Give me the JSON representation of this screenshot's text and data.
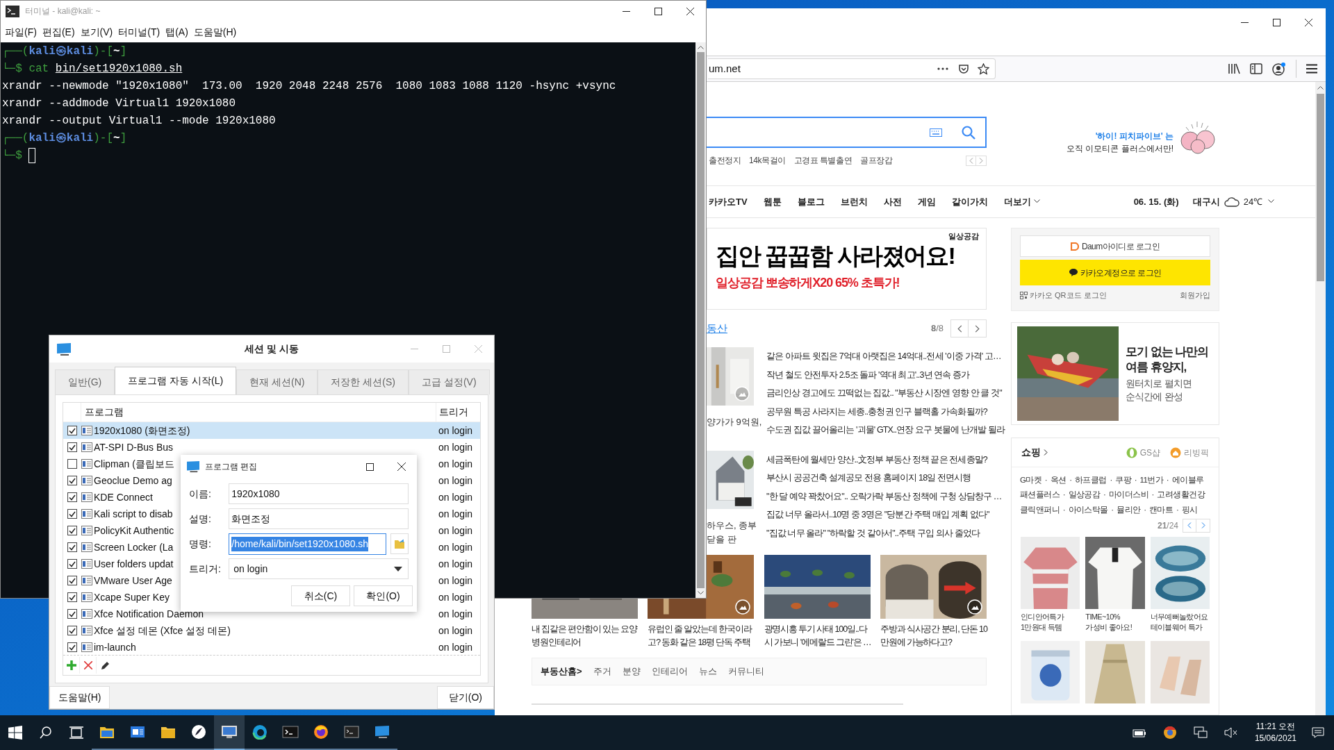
{
  "terminal": {
    "title": "터미널 - kali@kali: ~",
    "menu": [
      "파일(F)",
      "편집(E)",
      "보기(V)",
      "터미널(T)",
      "탭(A)",
      "도움말(H)"
    ],
    "lines": [
      {
        "kind": "prompt",
        "corner": "┌──(",
        "user": "kali",
        "at": "㉿",
        "host": "kali",
        "mid": ")-[",
        "dir": "~",
        "end": "]"
      },
      {
        "kind": "command",
        "corner": "└─$",
        "command": "cat",
        "argument": "bin/set1920x1080.sh"
      },
      {
        "kind": "output",
        "text": "xrandr --newmode \"1920x1080\"  173.00  1920 2048 2248 2576  1080 1083 1088 1120 -hsync +vsync"
      },
      {
        "kind": "output",
        "text": "xrandr --addmode Virtual1 1920x1080"
      },
      {
        "kind": "output",
        "text": "xrandr --output Virtual1 --mode 1920x1080"
      },
      {
        "kind": "prompt",
        "corner": "┌──(",
        "user": "kali",
        "at": "㉿",
        "host": "kali",
        "mid": ")-[",
        "dir": "~",
        "end": "]"
      },
      {
        "kind": "input",
        "corner": "└─$",
        "cursor": true
      }
    ]
  },
  "session_dialog": {
    "title": "세션 및 시동",
    "tabs": [
      {
        "label": "일반(G)",
        "selected": false
      },
      {
        "label": "프로그램 자동 시작(L)",
        "selected": true
      },
      {
        "label": "현재 세션(N)",
        "selected": false
      },
      {
        "label": "저장한 세션(S)",
        "selected": false
      },
      {
        "label": "고급 설정(V)",
        "selected": false
      }
    ],
    "columns": [
      "프로그램",
      "트리거"
    ],
    "rows": [
      {
        "name": "1920x1080 (화면조정)",
        "trigger": "on login",
        "checked": true,
        "selected": true
      },
      {
        "name": "AT-SPI D-Bus Bus",
        "trigger": "on login",
        "checked": true,
        "selected": false
      },
      {
        "name": "Clipman (클립보드",
        "trigger": "on login",
        "checked": false,
        "selected": false
      },
      {
        "name": "Geoclue Demo ag",
        "trigger": "on login",
        "checked": true,
        "selected": false
      },
      {
        "name": "KDE Connect",
        "trigger": "on login",
        "checked": true,
        "selected": false
      },
      {
        "name": "Kali script to disab",
        "trigger": "on login",
        "checked": true,
        "selected": false
      },
      {
        "name": "PolicyKit Authentic",
        "trigger": "on login",
        "checked": true,
        "selected": false
      },
      {
        "name": "Screen Locker (La",
        "trigger": "on login",
        "checked": true,
        "selected": false
      },
      {
        "name": "User folders updat",
        "trigger": "on login",
        "checked": true,
        "selected": false
      },
      {
        "name": "VMware User Age",
        "trigger": "on login",
        "checked": true,
        "selected": false
      },
      {
        "name": "Xcape Super Key",
        "trigger": "on login",
        "checked": true,
        "selected": false
      },
      {
        "name": "Xfce Notification Daemon",
        "trigger": "on login",
        "checked": true,
        "selected": false
      },
      {
        "name": "Xfce 설정 데몬 (Xfce 설정 데몬)",
        "trigger": "on login",
        "checked": true,
        "selected": false
      },
      {
        "name": "im-launch",
        "trigger": "on login",
        "checked": true,
        "selected": false
      }
    ],
    "help_button": "도움말(H)",
    "close_button": "닫기(O)"
  },
  "edit_dialog": {
    "title": "프로그램 편집",
    "fields": [
      {
        "label": "이름:",
        "value": "1920x1080",
        "kind": "text",
        "selected": false
      },
      {
        "label": "설명:",
        "value": "화면조정",
        "kind": "text",
        "selected": false
      },
      {
        "label": "명령:",
        "value": "/home/kali/bin/set1920x1080.sh",
        "kind": "file",
        "selected": true
      },
      {
        "label": "트리거:",
        "value": "on login",
        "kind": "dropdown",
        "selected": false
      }
    ],
    "buttons": [
      "취소(C)",
      "확인(O)"
    ]
  },
  "browser": {
    "url": "um.net",
    "keywords": [
      "출전정지",
      "14k목걸이",
      "고경표 특별출연",
      "골프장갑"
    ],
    "promo": [
      "'하이! 피치파이브' 는",
      "오직 이모티콘 플러스에서만!"
    ],
    "nav": [
      "카카오TV",
      "웹툰",
      "블로그",
      "브런치",
      "사전",
      "게임",
      "같이가치",
      "더보기"
    ],
    "date": "06. 15. (화)",
    "city": "대구시",
    "temperature": "24℃",
    "ad_banner": {
      "brand": "일상공감",
      "headline": "집안 꿉꿉함 사라졌어요!",
      "offer": "일상공감 뽀송하게X20 **65%** 초특가!"
    },
    "section": {
      "title": "동산",
      "page": "**8**/8"
    },
    "news_groups": [
      {
        "thumb_gallery": true,
        "thumb_caption": [
          "양가가 9억원,"
        ],
        "headlines": [
          "같은 아파트 윗집은 7억대 아랫집은 14억대..전세 '이중 가격' 고…",
          "작년 철도 안전투자 2.5조 돌파 '역대 최고'..3년 연속 증가",
          "금리인상 경고에도 끄떡없는 집값.. \"부동산 시장엔 영향 안 클 것\"",
          "공무원 특공 사라지는 세종..충청권 인구 블랙홀 가속화될까?",
          "수도권 집값 끌어올리는 '괴물' GTX..연장 요구 봇물에 난개발 될라"
        ]
      },
      {
        "thumb_gallery": false,
        "thumb_caption": [
          "하우스, 종부",
          "닫을 판"
        ],
        "headlines": [
          "세금폭탄에 월세만 양산..文정부 부동산 정책 끝은 전세종말?",
          "부산시 공공건축 설계공모 전용 홈페이지 18일 전면시행",
          "\"한 달 예약 꽉찼어요\".. 오락가락 부동산 정책에 구청 상담창구 …",
          "집값 너무 올라서..10명 중 3명은 \"당분간 주택 매입 계획 없다\"",
          "\"집값 너무 올라\" \"하락할 것 같아서\"..주택 구입 의사 줄었다"
        ]
      }
    ],
    "tiles": [
      {
        "gallery": false,
        "caption": [
          "내 집같은 편안함이 있는 요양",
          "병원인테리어"
        ]
      },
      {
        "gallery": true,
        "caption": [
          "유럽인 줄 알았는데 한국이라",
          "고? 동화 같은 18평 단독 주택"
        ]
      },
      {
        "gallery": false,
        "caption": [
          "광명시흥 투기 사태 100일..다",
          "시 가보니 '에메랄드 그린'은 …"
        ]
      },
      {
        "gallery": true,
        "caption": [
          "주방과 식사공간 분리, 단돈 10",
          "만원에 가능하다고?"
        ]
      }
    ],
    "home_bar": {
      "home": "부동산홈>",
      "links": [
        "주거",
        "분양",
        "인테리어",
        "뉴스",
        "커뮤니티"
      ]
    },
    "login": {
      "daum": "Daum아이디로 로그인",
      "kakao": "카카오계정으로 로그인",
      "qr": "카카오 QR코드 로그인",
      "join": "회원가입"
    },
    "ad_card": {
      "title": [
        "모기 없는 나만의",
        "여름 휴양지,"
      ],
      "text": [
        "원터치로 펼치면",
        "순식간에 완성"
      ]
    },
    "shopping": {
      "title": "쇼핑",
      "partners": [
        "GS샵",
        "리빙픽"
      ],
      "links": [
        "G마켓 · 옥션 · 하프클럽 · 쿠팡 · 11번가 · 에이블루",
        "패션플러스 · 일상공감 · 마이더스비 · 고려생활건강",
        "클릭앤퍼니 · 아이스탁몰 · 뮬리안 · 캔마트 · 핑시"
      ],
      "page": "**21**/24",
      "products": [
        {
          "caption": [
            "인디안어특가",
            "1만원대 득템"
          ]
        },
        {
          "caption": [
            "TIME~10%",
            "가성비 좋아요!"
          ]
        },
        {
          "caption": [
            "너무예뻐놀랐어요",
            "테이블웨어 특가"
          ]
        }
      ]
    }
  },
  "taskbar": {
    "apps": [
      {
        "selected": false
      },
      {
        "selected": false
      },
      {
        "selected": false
      },
      {
        "selected": false
      },
      {
        "selected": true
      },
      {
        "selected": false
      },
      {
        "selected": false
      },
      {
        "selected": false
      },
      {
        "selected": false
      },
      {
        "selected": false
      }
    ],
    "time": "11:21 오전",
    "date": "15/06/2021"
  }
}
